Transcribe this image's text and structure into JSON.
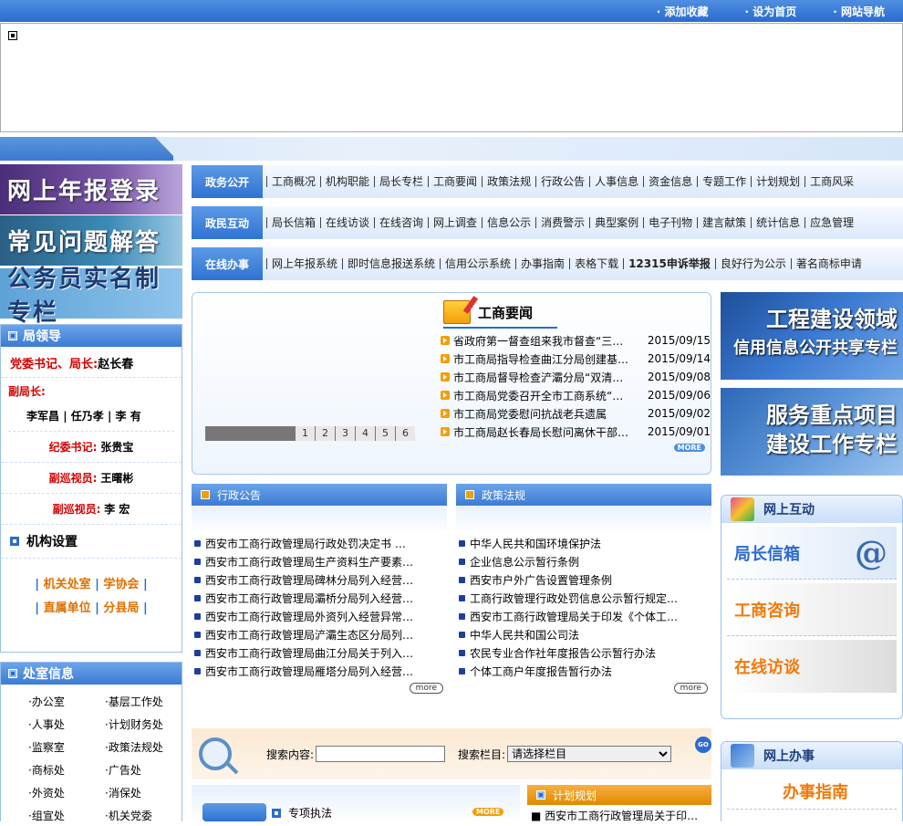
{
  "top_links": [
    "· 添加收藏",
    "· 设为首页",
    "· 网站导航"
  ],
  "left_banners": [
    "网上年报登录",
    "常见问题解答",
    "公务员实名制专栏"
  ],
  "leaders": {
    "title": "局领导",
    "party_secretary_label": "党委书记、局长:",
    "party_secretary_name": "赵长春",
    "deputy_label": "副局长:",
    "deputies": [
      "李军昌",
      "任乃孝",
      "李  有"
    ],
    "discipline_label": "纪委书记:",
    "discipline_name": "张贵宝",
    "inspector1_label": "副巡视员:",
    "inspector1_name": "王曙彬",
    "inspector2_label": "副巡视员:",
    "inspector2_name": "李  宏"
  },
  "org": {
    "title": "机构设置",
    "links": [
      [
        "机关处室",
        "学协会"
      ],
      [
        "直属单位",
        "分县局"
      ]
    ]
  },
  "dept": {
    "title": "处室信息",
    "items": [
      "·办公室",
      "·基层工作处",
      "·人事处",
      "·计划财务处",
      "·监察室",
      "·政策法规处",
      "·商标处",
      "·广告处",
      "·外资处",
      "·消保处",
      "·组宣处",
      "·机关党委"
    ]
  },
  "nav": [
    {
      "label": "政务公开",
      "items": [
        "工商概况",
        "机构职能",
        "局长专栏",
        "工商要闻",
        "政策法规",
        "行政公告",
        "人事信息",
        "资金信息",
        "专题工作",
        "计划规划",
        "工商风采"
      ]
    },
    {
      "label": "政民互动",
      "items": [
        "局长信箱",
        "在线访谈",
        "在线咨询",
        "网上调查",
        "信息公示",
        "消费警示",
        "典型案例",
        "电子刊物",
        "建言献策",
        "统计信息",
        "应急管理"
      ]
    },
    {
      "label": "在线办事",
      "items": [
        "网上年报系统",
        "即时信息报送系统",
        "信用公示系统",
        "办事指南",
        "表格下载",
        "12315申诉举报",
        "良好行为公示",
        "著名商标申请"
      ]
    }
  ],
  "news": {
    "title": "工商要闻",
    "pages": [
      "1",
      "2",
      "3",
      "4",
      "5",
      "6"
    ],
    "more": "MORE",
    "items": [
      {
        "title": "省政府第一督查组来我市督查“三…",
        "date": "2015/09/15"
      },
      {
        "title": "市工商局指导检查曲江分局创建基…",
        "date": "2015/09/14"
      },
      {
        "title": "市工商局督导检查浐灞分局“双清…",
        "date": "2015/09/08"
      },
      {
        "title": "市工商局党委召开全市工商系统“…",
        "date": "2015/09/06"
      },
      {
        "title": "市工商局党委慰问抗战老兵遗属",
        "date": "2015/09/02"
      },
      {
        "title": "市工商局赵长春局长慰问离休干部…",
        "date": "2015/09/01"
      }
    ]
  },
  "right_banners": [
    {
      "line1": "工程建设领域",
      "line2": "信用信息公开共享专栏"
    },
    {
      "line1": "服务重点项目",
      "line2": "建设工作专栏"
    }
  ],
  "announce": {
    "title": "行政公告",
    "more": "more",
    "items": [
      "西安市工商行政管理局行政处罚决定书 …",
      "西安市工商行政管理局生产资料生产要素…",
      "西安市工商行政管理局碑林分局列入经营…",
      "西安市工商行政管理局灞桥分局列入经营…",
      "西安市工商行政管理局外资列入经营异常…",
      "西安市工商行政管理局浐灞生态区分局列…",
      "西安市工商行政管理局曲江分局关于列入…",
      "西安市工商行政管理局雁塔分局列入经营…"
    ]
  },
  "policy": {
    "title": "政策法规",
    "more": "more",
    "items": [
      "中华人民共和国环境保护法",
      "企业信息公示暂行条例",
      "西安市户外广告设置管理条例",
      "工商行政管理行政处罚信息公示暂行规定…",
      "西安市工商行政管理局关于印发《个体工…",
      "中华人民共和国公司法",
      "农民专业合作社年度报告公示暂行办法",
      "个体工商户年度报告暂行办法"
    ]
  },
  "search": {
    "content_label": "搜索内容:",
    "column_label": "搜索栏目:",
    "column_value": "请选择栏目",
    "go": "GO"
  },
  "interact": {
    "title": "网上互动",
    "items": [
      "局长信箱",
      "工商咨询",
      "在线访谈"
    ]
  },
  "online_service": {
    "title": "网上办事",
    "items": [
      "办事指南"
    ]
  },
  "special": {
    "title": "专项执法",
    "more": "MORE"
  },
  "plan": {
    "title": "计划规划",
    "first_item": "西安市工商行政管理局关于印…"
  },
  "colors": {
    "primary_blue": "#2a6bd0",
    "red": "#d10000",
    "orange": "#f29e0b"
  }
}
